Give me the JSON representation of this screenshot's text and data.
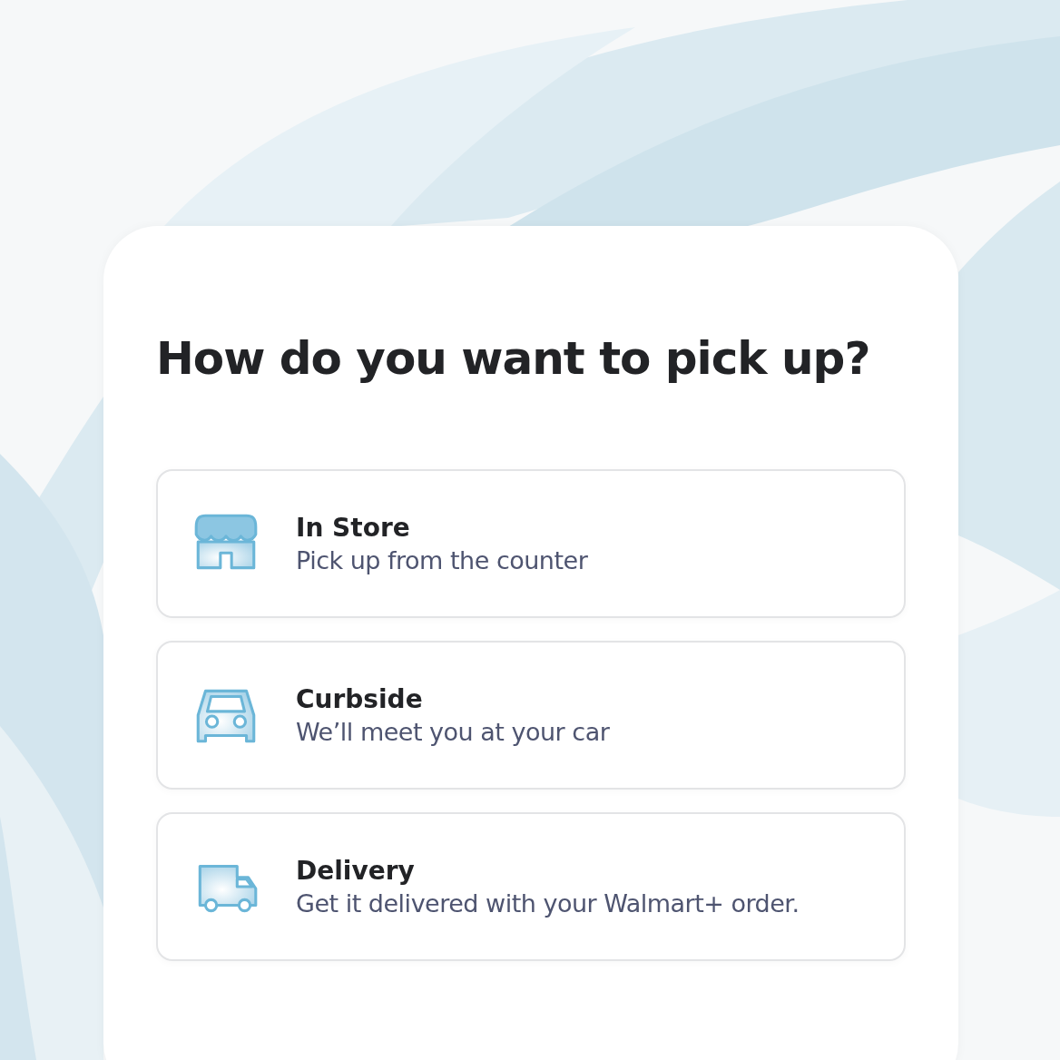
{
  "title": "How do you want to pick up?",
  "options": [
    {
      "kind": "store",
      "label": "In Store",
      "description": "Pick up from the counter"
    },
    {
      "kind": "car",
      "label": "Curbside",
      "description": "We’ll meet you at your car"
    },
    {
      "kind": "truck",
      "label": "Delivery",
      "description": "Get it delivered with your Walmart+ order."
    }
  ]
}
